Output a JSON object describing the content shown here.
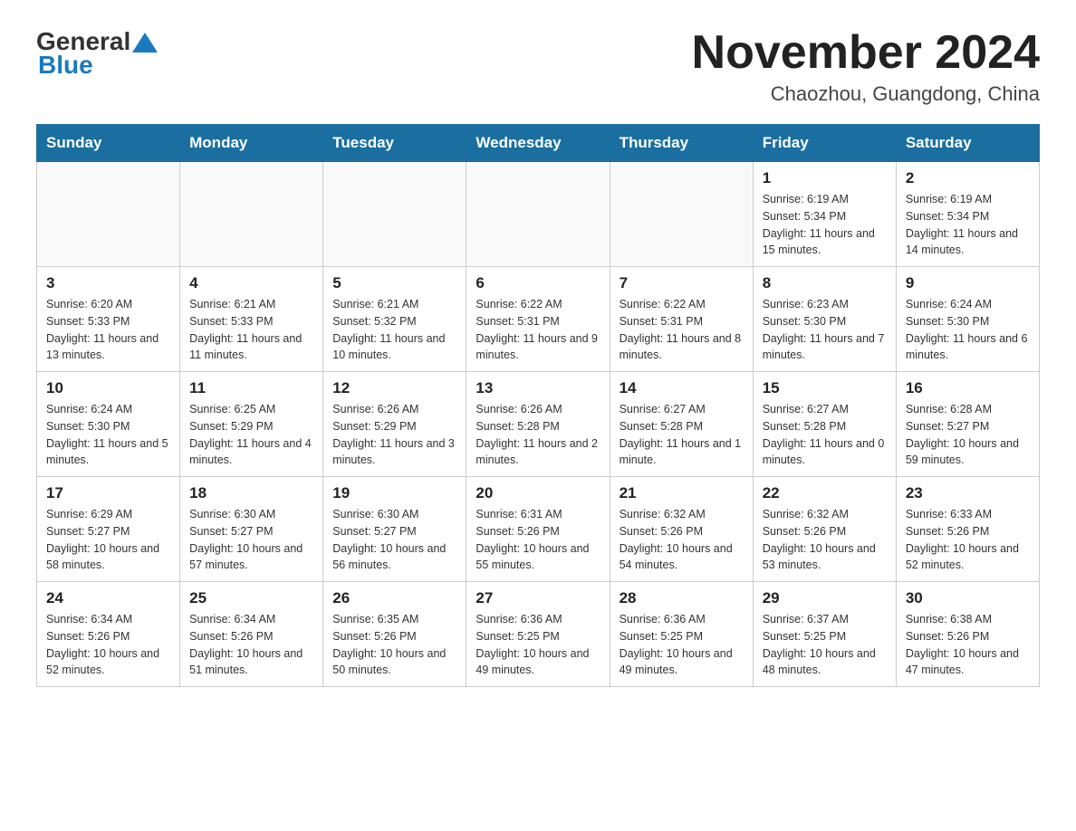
{
  "header": {
    "logo_general": "General",
    "logo_blue": "Blue",
    "month_title": "November 2024",
    "location": "Chaozhou, Guangdong, China"
  },
  "weekdays": [
    "Sunday",
    "Monday",
    "Tuesday",
    "Wednesday",
    "Thursday",
    "Friday",
    "Saturday"
  ],
  "weeks": [
    [
      {
        "day": "",
        "info": ""
      },
      {
        "day": "",
        "info": ""
      },
      {
        "day": "",
        "info": ""
      },
      {
        "day": "",
        "info": ""
      },
      {
        "day": "",
        "info": ""
      },
      {
        "day": "1",
        "info": "Sunrise: 6:19 AM\nSunset: 5:34 PM\nDaylight: 11 hours and 15 minutes."
      },
      {
        "day": "2",
        "info": "Sunrise: 6:19 AM\nSunset: 5:34 PM\nDaylight: 11 hours and 14 minutes."
      }
    ],
    [
      {
        "day": "3",
        "info": "Sunrise: 6:20 AM\nSunset: 5:33 PM\nDaylight: 11 hours and 13 minutes."
      },
      {
        "day": "4",
        "info": "Sunrise: 6:21 AM\nSunset: 5:33 PM\nDaylight: 11 hours and 11 minutes."
      },
      {
        "day": "5",
        "info": "Sunrise: 6:21 AM\nSunset: 5:32 PM\nDaylight: 11 hours and 10 minutes."
      },
      {
        "day": "6",
        "info": "Sunrise: 6:22 AM\nSunset: 5:31 PM\nDaylight: 11 hours and 9 minutes."
      },
      {
        "day": "7",
        "info": "Sunrise: 6:22 AM\nSunset: 5:31 PM\nDaylight: 11 hours and 8 minutes."
      },
      {
        "day": "8",
        "info": "Sunrise: 6:23 AM\nSunset: 5:30 PM\nDaylight: 11 hours and 7 minutes."
      },
      {
        "day": "9",
        "info": "Sunrise: 6:24 AM\nSunset: 5:30 PM\nDaylight: 11 hours and 6 minutes."
      }
    ],
    [
      {
        "day": "10",
        "info": "Sunrise: 6:24 AM\nSunset: 5:30 PM\nDaylight: 11 hours and 5 minutes."
      },
      {
        "day": "11",
        "info": "Sunrise: 6:25 AM\nSunset: 5:29 PM\nDaylight: 11 hours and 4 minutes."
      },
      {
        "day": "12",
        "info": "Sunrise: 6:26 AM\nSunset: 5:29 PM\nDaylight: 11 hours and 3 minutes."
      },
      {
        "day": "13",
        "info": "Sunrise: 6:26 AM\nSunset: 5:28 PM\nDaylight: 11 hours and 2 minutes."
      },
      {
        "day": "14",
        "info": "Sunrise: 6:27 AM\nSunset: 5:28 PM\nDaylight: 11 hours and 1 minute."
      },
      {
        "day": "15",
        "info": "Sunrise: 6:27 AM\nSunset: 5:28 PM\nDaylight: 11 hours and 0 minutes."
      },
      {
        "day": "16",
        "info": "Sunrise: 6:28 AM\nSunset: 5:27 PM\nDaylight: 10 hours and 59 minutes."
      }
    ],
    [
      {
        "day": "17",
        "info": "Sunrise: 6:29 AM\nSunset: 5:27 PM\nDaylight: 10 hours and 58 minutes."
      },
      {
        "day": "18",
        "info": "Sunrise: 6:30 AM\nSunset: 5:27 PM\nDaylight: 10 hours and 57 minutes."
      },
      {
        "day": "19",
        "info": "Sunrise: 6:30 AM\nSunset: 5:27 PM\nDaylight: 10 hours and 56 minutes."
      },
      {
        "day": "20",
        "info": "Sunrise: 6:31 AM\nSunset: 5:26 PM\nDaylight: 10 hours and 55 minutes."
      },
      {
        "day": "21",
        "info": "Sunrise: 6:32 AM\nSunset: 5:26 PM\nDaylight: 10 hours and 54 minutes."
      },
      {
        "day": "22",
        "info": "Sunrise: 6:32 AM\nSunset: 5:26 PM\nDaylight: 10 hours and 53 minutes."
      },
      {
        "day": "23",
        "info": "Sunrise: 6:33 AM\nSunset: 5:26 PM\nDaylight: 10 hours and 52 minutes."
      }
    ],
    [
      {
        "day": "24",
        "info": "Sunrise: 6:34 AM\nSunset: 5:26 PM\nDaylight: 10 hours and 52 minutes."
      },
      {
        "day": "25",
        "info": "Sunrise: 6:34 AM\nSunset: 5:26 PM\nDaylight: 10 hours and 51 minutes."
      },
      {
        "day": "26",
        "info": "Sunrise: 6:35 AM\nSunset: 5:26 PM\nDaylight: 10 hours and 50 minutes."
      },
      {
        "day": "27",
        "info": "Sunrise: 6:36 AM\nSunset: 5:25 PM\nDaylight: 10 hours and 49 minutes."
      },
      {
        "day": "28",
        "info": "Sunrise: 6:36 AM\nSunset: 5:25 PM\nDaylight: 10 hours and 49 minutes."
      },
      {
        "day": "29",
        "info": "Sunrise: 6:37 AM\nSunset: 5:25 PM\nDaylight: 10 hours and 48 minutes."
      },
      {
        "day": "30",
        "info": "Sunrise: 6:38 AM\nSunset: 5:26 PM\nDaylight: 10 hours and 47 minutes."
      }
    ]
  ]
}
